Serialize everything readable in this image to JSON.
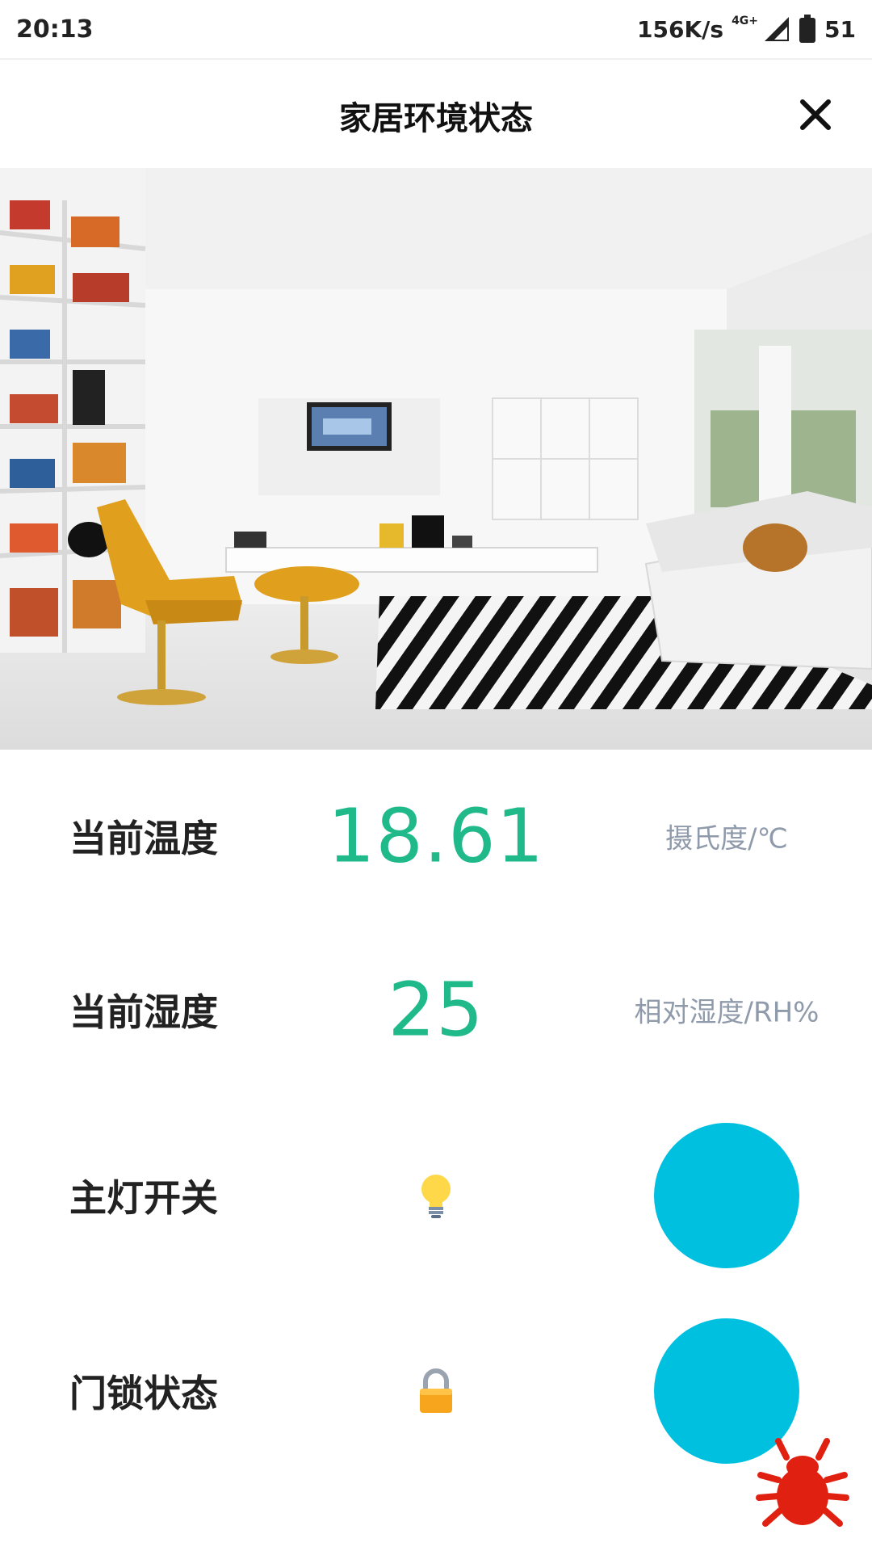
{
  "status_bar": {
    "time": "20:13",
    "net_speed": "156K/s",
    "net_type": "4G+",
    "battery": "51"
  },
  "header": {
    "title": "家居环境状态"
  },
  "rows": [
    {
      "label": "当前温度",
      "value": "18.61",
      "unit": "摄氏度/℃"
    },
    {
      "label": "当前湿度",
      "value": "25",
      "unit": "相对湿度/RH%"
    },
    {
      "label": "主灯开关",
      "icon": "lightbulb-icon"
    },
    {
      "label": "门锁状态",
      "icon": "lock-icon"
    }
  ],
  "colors": {
    "value": "#1fb98a",
    "unit": "#8f9aab",
    "toggle": "#00c0e0",
    "bug": "#e02010"
  }
}
